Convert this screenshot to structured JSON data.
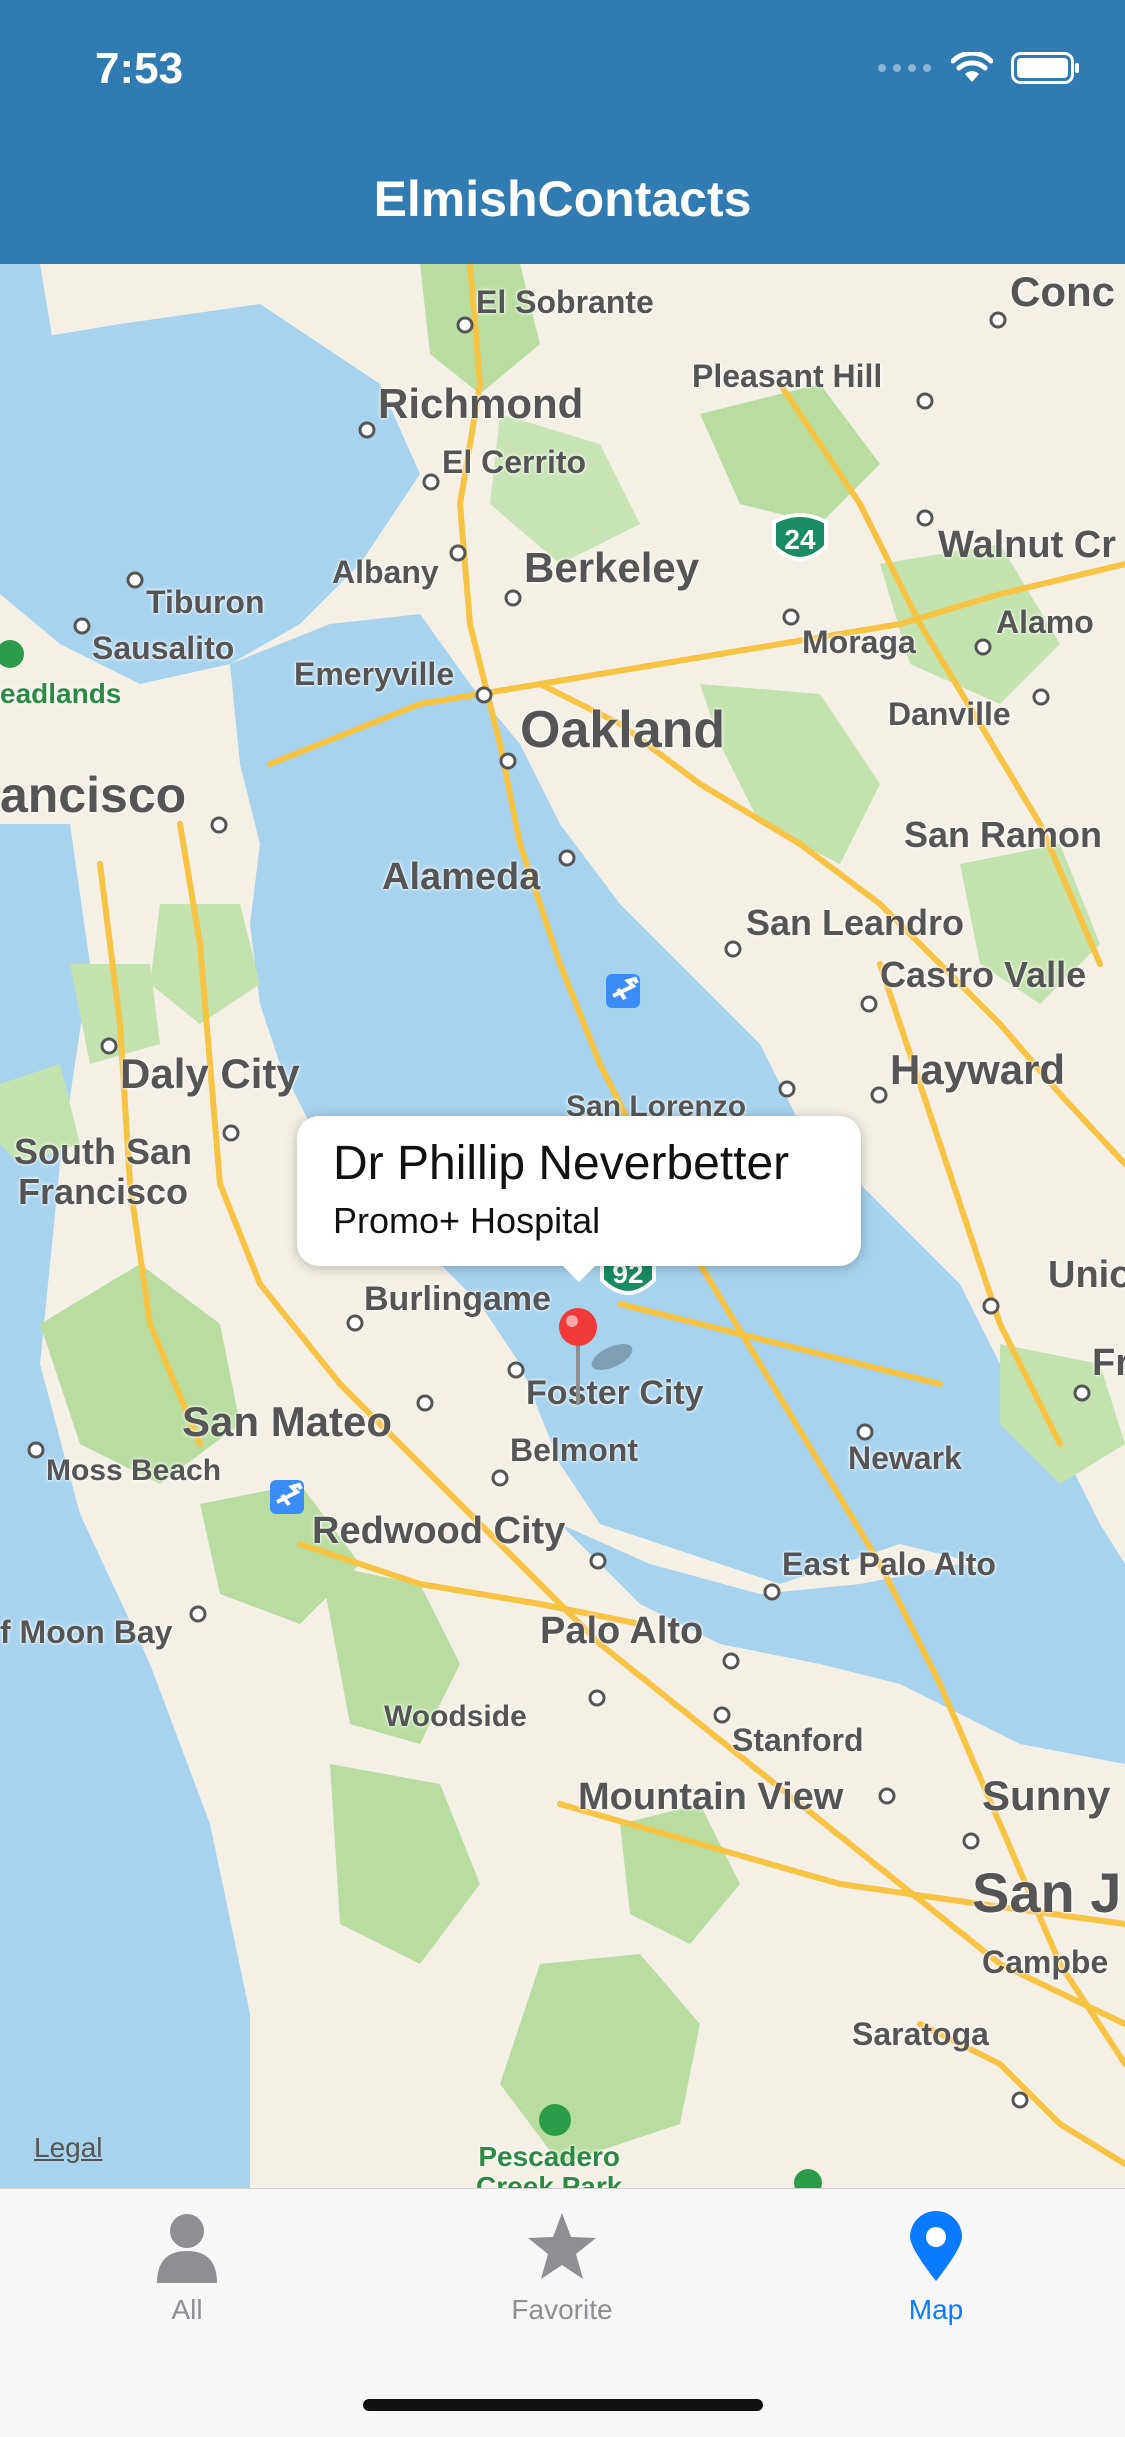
{
  "status_bar": {
    "time": "7:53"
  },
  "header": {
    "title": "ElmishContacts"
  },
  "map": {
    "legal": "Legal",
    "places": {
      "el_sobrante": "El Sobrante",
      "concord": "Conc",
      "pleasant_hill": "Pleasant Hill",
      "richmond": "Richmond",
      "el_cerrito": "El Cerrito",
      "walnut_creek": "Walnut Cr",
      "albany": "Albany",
      "berkeley": "Berkeley",
      "tiburon": "Tiburon",
      "sausalito": "Sausalito",
      "moraga": "Moraga",
      "alamo": "Alamo",
      "headlands": "eadlands",
      "emeryville": "Emeryville",
      "danville": "Danville",
      "oakland": "Oakland",
      "san_francisco": "ancisco",
      "san_ramon": "San Ramon",
      "alameda": "Alameda",
      "san_leandro": "San Leandro",
      "castro_valley": "Castro Valle",
      "daly_city": "Daly City",
      "hayward": "Hayward",
      "san_lorenzo": "San Lorenzo",
      "south_sf": "South San\nFrancisco",
      "burlingame": "Burlingame",
      "union_city": "Union",
      "fremont": "Fr",
      "foster_city": "Foster City",
      "san_mateo": "San Mateo",
      "moss_beach": "Moss Beach",
      "belmont": "Belmont",
      "newark": "Newark",
      "redwood_city": "Redwood City",
      "east_palo_alto": "East Palo Alto",
      "half_moon_bay": "f Moon Bay",
      "palo_alto": "Palo Alto",
      "woodside": "Woodside",
      "stanford": "Stanford",
      "mountain_view": "Mountain View",
      "sunnyvale": "Sunny",
      "san_jose": "San J",
      "campbell": "Campbe",
      "saratoga": "Saratoga",
      "pescadero": "Pescadero\nCreek Park"
    },
    "highways": {
      "h24": "24",
      "h92": "92"
    },
    "callout": {
      "name": "Dr Phillip Neverbetter",
      "organization": "Promo+ Hospital"
    }
  },
  "tabbar": {
    "tabs": [
      {
        "label": "All",
        "icon": "person-icon"
      },
      {
        "label": "Favorite",
        "icon": "star-icon"
      },
      {
        "label": "Map",
        "icon": "map-pin-icon"
      }
    ],
    "active_color": "#0a7aff",
    "inactive_color": "#8e8e93"
  }
}
